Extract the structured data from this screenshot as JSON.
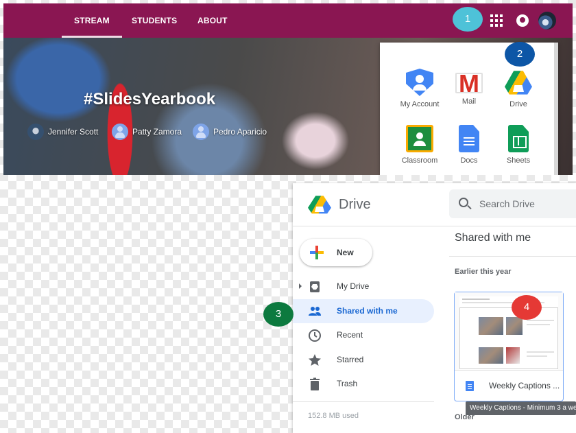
{
  "classroom": {
    "tabs": [
      {
        "label": "STREAM",
        "active": true
      },
      {
        "label": "STUDENTS",
        "active": false
      },
      {
        "label": "ABOUT",
        "active": false
      }
    ],
    "banner_title": "#SlidesYearbook",
    "teachers": [
      "Jennifer Scott",
      "Patty Zamora",
      "Pedro Aparicio"
    ],
    "apps": [
      {
        "label": "My Account",
        "icon": "account-icon"
      },
      {
        "label": "Mail",
        "icon": "gmail-icon"
      },
      {
        "label": "Drive",
        "icon": "drive-icon"
      },
      {
        "label": "Classroom",
        "icon": "classroom-icon"
      },
      {
        "label": "Docs",
        "icon": "docs-icon"
      },
      {
        "label": "Sheets",
        "icon": "sheets-icon"
      }
    ],
    "theme_color": "#8a1652"
  },
  "drive": {
    "title": "Drive",
    "search_placeholder": "Search Drive",
    "new_label": "New",
    "nav": [
      {
        "label": "My Drive",
        "icon": "my-drive-icon",
        "selected": false
      },
      {
        "label": "Shared with me",
        "icon": "shared-people-icon",
        "selected": true
      },
      {
        "label": "Recent",
        "icon": "clock-icon",
        "selected": false
      },
      {
        "label": "Starred",
        "icon": "star-icon",
        "selected": false
      },
      {
        "label": "Trash",
        "icon": "trash-icon",
        "selected": false
      }
    ],
    "storage": "152.8 MB used",
    "section_title": "Shared with me",
    "group_label": "Earlier this year",
    "file_name": "Weekly Captions ...",
    "tooltip": "Weekly Captions - Minimum 3 a we",
    "group_label_older": "Older",
    "accent_color": "#1967d2"
  },
  "markers": [
    "1",
    "2",
    "3",
    "4"
  ]
}
